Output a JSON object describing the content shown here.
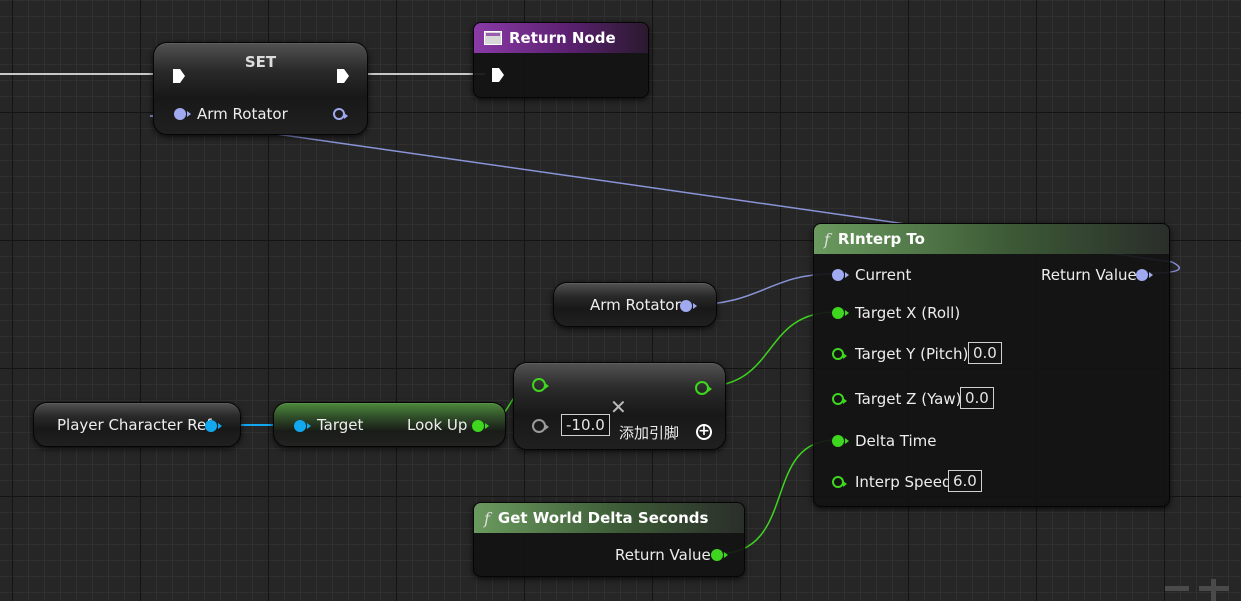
{
  "nodes": {
    "set": {
      "title": "SET",
      "pin_label": "Arm Rotator"
    },
    "return_node": {
      "title": "Return Node"
    },
    "rinterp": {
      "title": "RInterp To",
      "inputs": {
        "current": "Current",
        "target_x": "Target X (Roll)",
        "target_y": "Target Y (Pitch)",
        "target_z": "Target Z (Yaw)",
        "delta_time": "Delta Time",
        "interp_speed": "Interp Speed"
      },
      "values": {
        "target_y": "0.0",
        "target_z": "0.0",
        "interp_speed": "6.0"
      },
      "output": "Return Value"
    },
    "arm_rotator_getter": {
      "label": "Arm Rotator"
    },
    "multiply": {
      "value": "-10.0",
      "add_pin_label": "添加引脚"
    },
    "player_character_ref": {
      "label": "Player Character Ref"
    },
    "look_up": {
      "input": "Target",
      "output": "Look Up"
    },
    "get_world_delta_seconds": {
      "title": "Get World Delta Seconds",
      "output": "Return Value"
    }
  },
  "colors": {
    "rotator_pin": "#a0aaf0",
    "float_pin": "#3ed61e",
    "object_pin": "#11a8f0",
    "exec_pin": "#ffffff",
    "function_header": "#6a9a5e",
    "return_header": "#8a3aa6"
  },
  "icons": [
    "function-icon",
    "return-node-icon",
    "exec-pin-icon",
    "add-pin-icon",
    "multiply-icon"
  ]
}
